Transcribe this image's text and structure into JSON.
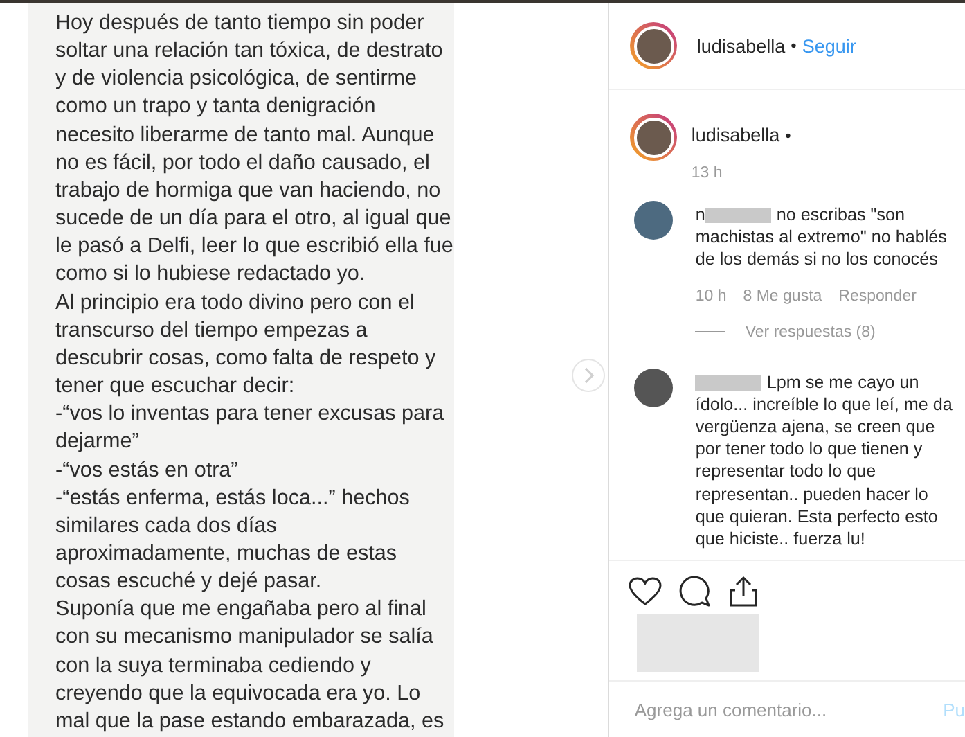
{
  "post": {
    "text_lines": [
      "Hoy después de tanto tiempo sin poder",
      "soltar una relación tan tóxica, de destrato",
      "y de violencia psicológica, de sentirme",
      "como un trapo y tanta denigración",
      "necesito liberarme de tanto mal. Aunque",
      "no es fácil, por todo el daño causado, el",
      "trabajo de hormiga que van haciendo, no",
      "sucede de un día para el otro, al igual que",
      "le pasó a Delfi, leer lo que escribió ella fue",
      "como si lo hubiese redactado yo.",
      "Al principio era todo divino pero con el",
      "transcurso del tiempo empezas a",
      "descubrir cosas, como falta de respeto y",
      "tener que escuchar decir:",
      "-“vos lo inventas para tener excusas para",
      "dejarme”",
      "-“vos estás en otra”",
      "-“estás enferma, estás loca...”  hechos",
      "similares cada dos días",
      "aproximadamente, muchas de estas",
      "cosas escuché y dejé pasar.",
      "Suponía que me engañaba pero al final",
      "con su mecanismo manipulador se salía",
      "con la suya terminaba cediendo y",
      "creyendo que la equivocada era yo. Lo",
      "mal que la pase estando embarazada, es"
    ]
  },
  "header": {
    "username": "ludisabella",
    "separator": "•",
    "follow": "Seguir"
  },
  "caption": {
    "username": "ludisabella",
    "separator": "•",
    "time": "13 h"
  },
  "comments": [
    {
      "username": "n",
      "text": "no escribas \"son machistas al extremo\" no hablés de los demás si no los conocés",
      "time": "10 h",
      "likes": "8 Me gusta",
      "reply": "Responder",
      "replies": "Ver respuestas (8)"
    },
    {
      "text": "Lpm se me cayo un ídolo... increíble lo que leí, me da vergüenza ajena, se creen que por tener todo lo que tienen y representar todo lo que representan.. pueden hacer lo que quieran. Esta perfecto esto que hiciste.. fuerza lu!"
    }
  ],
  "add_comment": {
    "placeholder": "Agrega un comentario...",
    "post": "Pu"
  }
}
